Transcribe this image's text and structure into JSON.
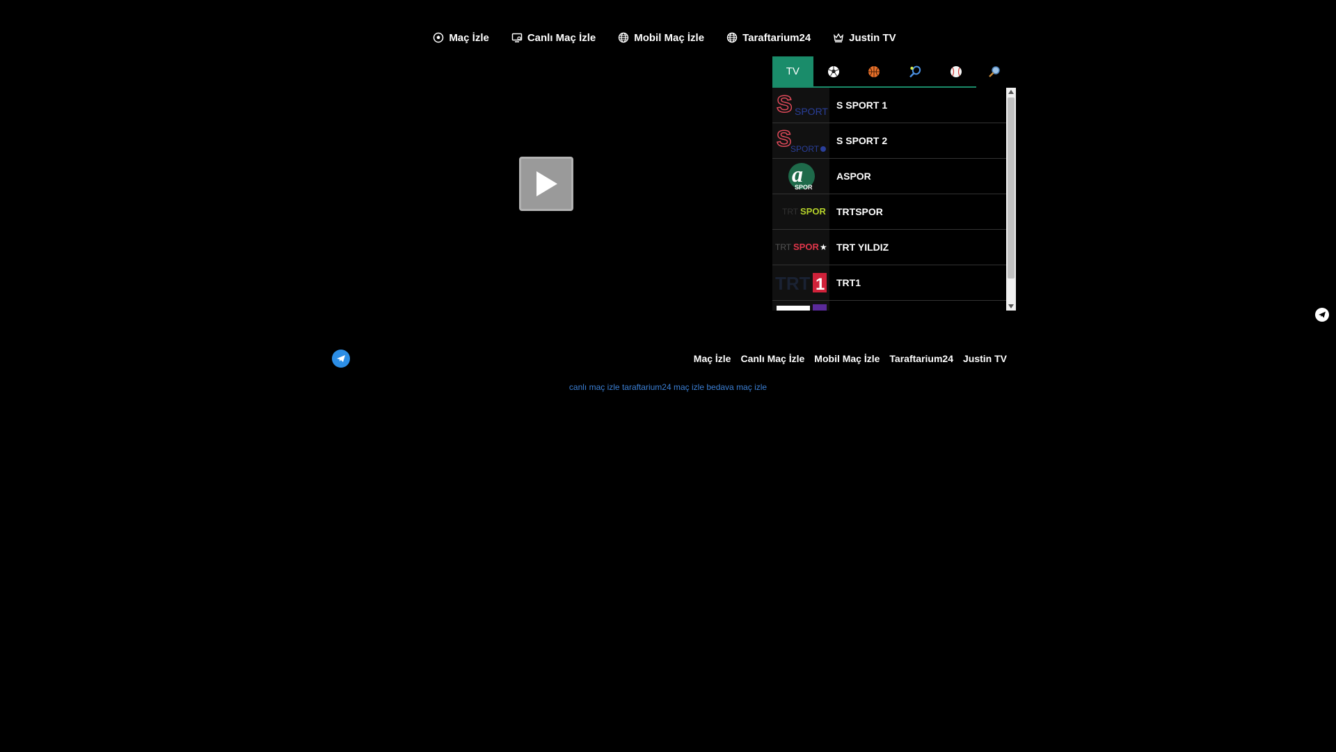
{
  "nav": {
    "items": [
      {
        "label": "Maç İzle",
        "icon": "soccer-ball-icon"
      },
      {
        "label": "Canlı Maç İzle",
        "icon": "tv-icon"
      },
      {
        "label": "Mobil Maç İzle",
        "icon": "globe-icon"
      },
      {
        "label": "Taraftarium24",
        "icon": "globe-icon"
      },
      {
        "label": "Justin TV",
        "icon": "crown-icon"
      }
    ]
  },
  "tabs": {
    "tv": "TV",
    "icons": [
      "soccer-ball-icon",
      "basketball-icon",
      "tennis-icon",
      "baseball-icon",
      "search-icon"
    ]
  },
  "channels": [
    {
      "name": "S SPORT 1",
      "logo": "S SPORT"
    },
    {
      "name": "S SPORT 2",
      "logo": "S SPORT2"
    },
    {
      "name": "ASPOR",
      "logo": "a SPOR"
    },
    {
      "name": "TRTSPOR",
      "logo": "TRT SPOR"
    },
    {
      "name": "TRT YILDIZ",
      "logo": "TRT SPOR★"
    },
    {
      "name": "TRT1",
      "logo": "TRT 1"
    }
  ],
  "footer": {
    "links": [
      "Maç İzle",
      "Canlı Maç İzle",
      "Mobil Maç İzle",
      "Taraftarium24",
      "Justin TV"
    ],
    "seo": [
      "canlı maç izle",
      "taraftarium24",
      "maç izle",
      "bedava maç izle"
    ]
  },
  "colors": {
    "accent": "#1a8c6a",
    "link_blue": "#3b7fd4",
    "telegram": "#2c8ee6"
  }
}
